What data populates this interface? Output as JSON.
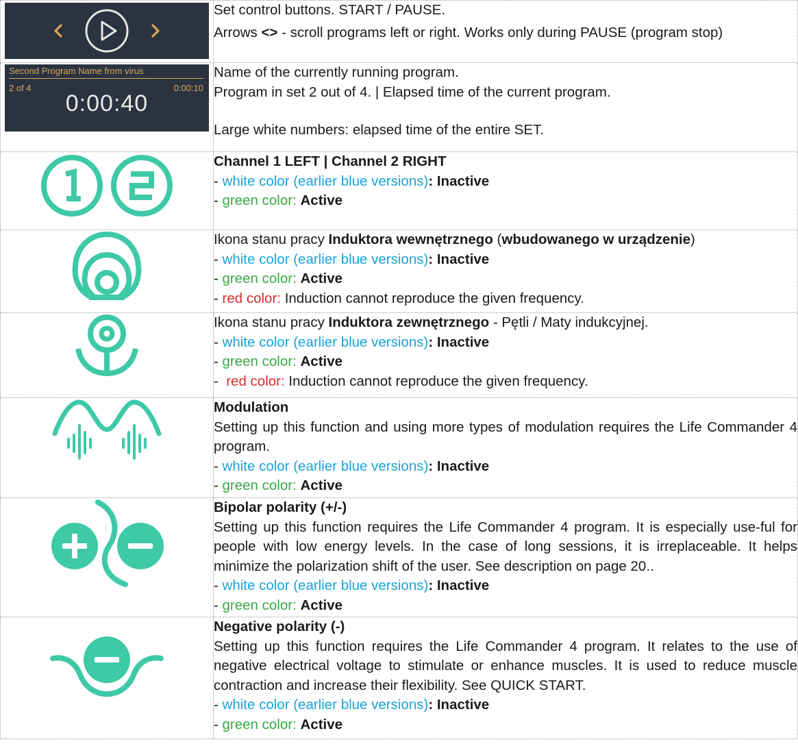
{
  "colors": {
    "teal": "#3ec9a7",
    "dark_panel": "#2b3341",
    "gold": "#d6a85a",
    "blue": "#1aa3d9",
    "green": "#3aa845",
    "red": "#d42e2e"
  },
  "icons": {
    "controls": [
      "chevron-left-icon",
      "play-icon",
      "chevron-right-icon"
    ],
    "channels": [
      "channel-1-icon",
      "channel-2-icon"
    ],
    "internal": "internal-inductor-icon",
    "external": "external-inductor-icon",
    "modulation": "modulation-icon",
    "bipolar": "bipolar-polarity-icon",
    "negative": "negative-polarity-icon"
  },
  "rows": {
    "controls": {
      "line1": "Set control buttons. START / PAUSE.",
      "line2_a": "Arrows ",
      "line2_arrows": "<>",
      "line2_b": " - scroll programs left or right. Works only during PAUSE (program stop)"
    },
    "program": {
      "panel_name": "Second Program Name from virus",
      "panel_set": "2 of 4",
      "panel_time": "0:00:10",
      "panel_total": "0:00:40",
      "line1": "Name of the currently running program.",
      "line2": "Program in set 2 out of 4. | Elapsed time of the current program.",
      "line3": "Large white numbers: elapsed time of the entire SET."
    },
    "channels": {
      "title": "Channel 1 LEFT | Channel 2 RIGHT",
      "white_label": "white color (earlier blue versions)",
      "inactive": "Inactive",
      "green_label": "green color:",
      "active": "Active"
    },
    "internal": {
      "pre": "Ikona stanu pracy ",
      "bold1": "Induktora wewnętrznego",
      "mid": " (",
      "bold2": "wbudowanego w urządzenie",
      "post": ")",
      "white_label": "white color (earlier blue versions)",
      "inactive": "Inactive",
      "green_label": "green color:",
      "active": "Active",
      "red_label": "red color:",
      "red_text": " Induction cannot reproduce the given frequency."
    },
    "external": {
      "pre": "Ikona stanu pracy ",
      "bold": "Induktora zewnętrznego",
      "post": " - Pętli / Maty indukcyjnej.",
      "white_label": "white color (earlier blue versions)",
      "inactive": "Inactive",
      "green_label": "green color:",
      "active": "Active",
      "red_label": "red color:",
      "red_text": " Induction cannot reproduce the given frequency."
    },
    "modulation": {
      "title": "Modulation",
      "desc": "Setting up this function and using more types of modulation requires the Life Commander 4 program.",
      "white_label": "white color (earlier blue versions)",
      "inactive": "Inactive",
      "green_label": "green color:",
      "active": "Active"
    },
    "bipolar": {
      "title": "Bipolar polarity (+/-)",
      "desc": "Setting up this function requires the Life Commander 4 program. It is especially use-ful for people with low energy levels. In the case of long sessions, it is irreplaceable. It helps minimize the polarization shift of the user. See description on page 20..",
      "white_label": "white color (earlier blue versions)",
      "inactive": "Inactive",
      "green_label": "green color:",
      "active": "Active"
    },
    "negative": {
      "title": "Negative polarity (-)",
      "desc": "Setting up this function requires the Life Commander 4 program. It relates to the use of negative electrical voltage to stimulate or enhance muscles. It is used to reduce muscle contraction and increase their flexibility. See QUICK START.",
      "white_label": "white color (earlier blue versions)",
      "inactive": "Inactive",
      "green_label": "green color:",
      "active": "Active"
    }
  }
}
